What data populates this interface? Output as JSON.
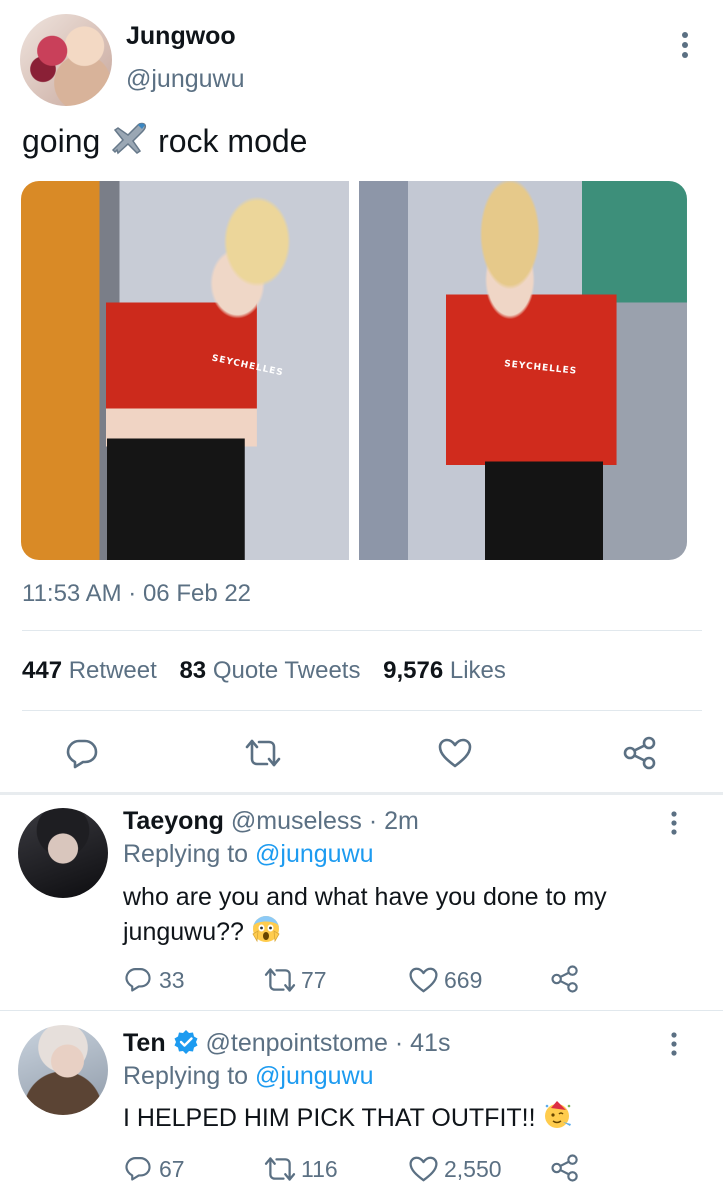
{
  "tweet": {
    "author_name": "Jungwoo",
    "author_handle": "@junguwu",
    "text_before": "going",
    "text_after": "rock mode",
    "timestamp": "11:53 AM · 06 Feb 22",
    "stats": {
      "retweets_count": "447",
      "retweets_label": "Retweet",
      "quotes_count": "83",
      "quotes_label": "Quote Tweets",
      "likes_count": "9,576",
      "likes_label": "Likes"
    },
    "photo_labels": [
      "SEYCHELLES",
      "SEYCHELLES"
    ],
    "actions": [
      "reply-icon",
      "retweet-icon",
      "like-icon",
      "share-icon"
    ]
  },
  "replies": [
    {
      "name": "Taeyong",
      "handle": "@museless",
      "time": "· 2m",
      "replying_label": "Replying to",
      "replying_to": "@junguwu",
      "line1": "who are you and what have you done to my",
      "line2": "junguwu??",
      "reply_count": "33",
      "retweet_count": "77",
      "like_count": "669"
    },
    {
      "name": "Ten",
      "handle": "@tenpointstome",
      "time": "· 41s",
      "replying_label": "Replying to",
      "replying_to": "@junguwu",
      "line1": "I HELPED HIM PICK THAT OUTFIT!!",
      "reply_count": "67",
      "retweet_count": "116",
      "like_count": "2,550"
    }
  ],
  "colors": {
    "accent": "#1d9bf0",
    "muted": "#5b7083",
    "text": "#0f1419",
    "divider": "#e1e8ed"
  }
}
